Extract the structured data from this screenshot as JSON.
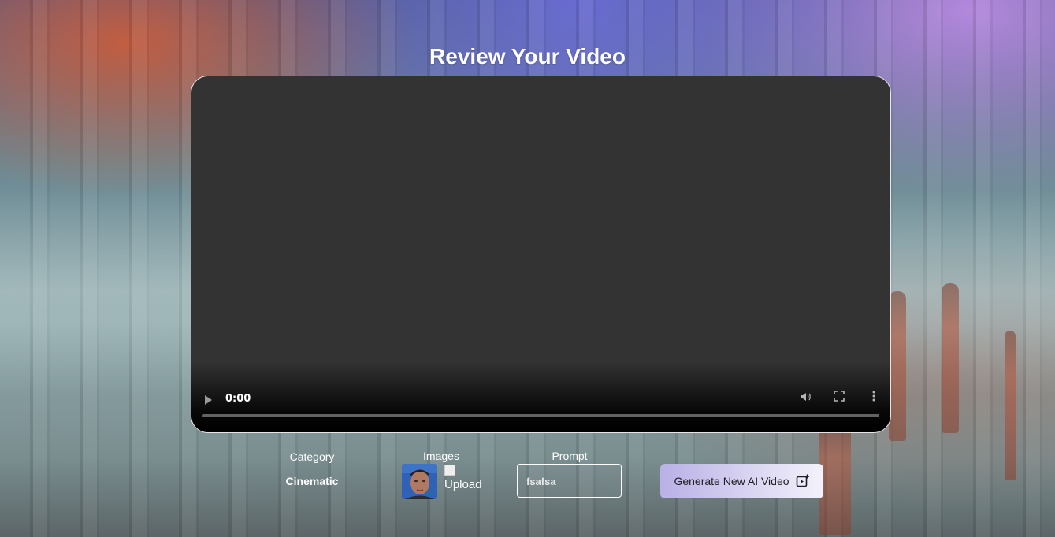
{
  "page": {
    "title": "Review Your Video"
  },
  "video_player": {
    "current_time": "0:00",
    "progress": 0,
    "icons": [
      "play-icon",
      "volume-icon",
      "fullscreen-icon",
      "more-options-icon"
    ]
  },
  "details": {
    "category_label": "Category",
    "category_value": "Cinematic",
    "images_label": "Images",
    "broken_image_alt": "Upload",
    "prompt_label": "Prompt",
    "prompt_value": "fsafsa"
  },
  "actions": {
    "generate_label": "Generate New AI Video",
    "generate_icon": "video-sparkle-icon"
  },
  "colors": {
    "video_background": "#333333",
    "button_gradient_start": "#b9b0e6",
    "button_gradient_end": "#f3f2fb",
    "title_color": "#ffffff"
  }
}
